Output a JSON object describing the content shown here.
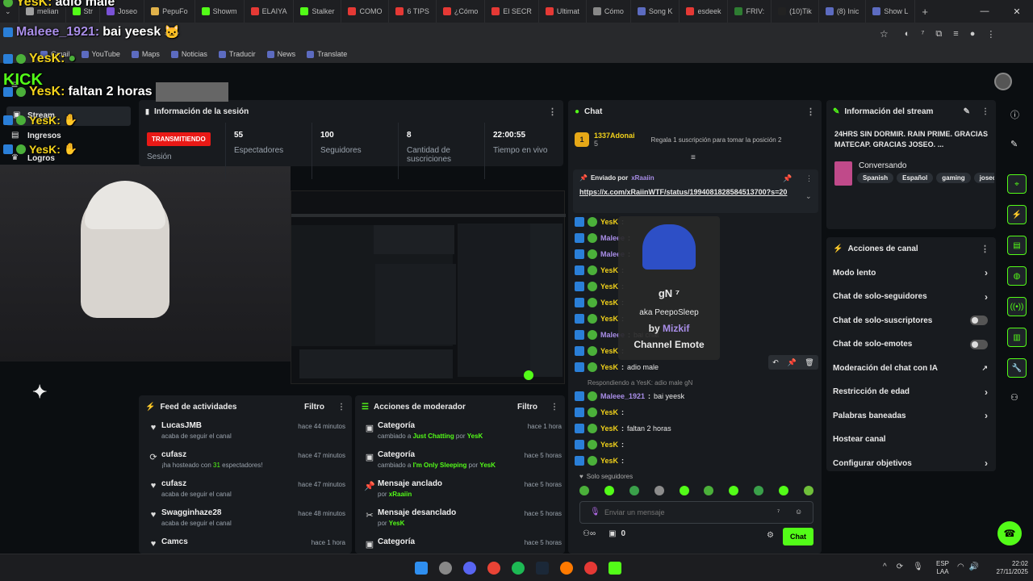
{
  "browser": {
    "tabs": [
      "melian",
      "Str",
      "Joseo",
      "PepuFo",
      "Showm",
      "ELAIYA",
      "Stalker",
      "COMO",
      "6 TIPS",
      "¿Cómo",
      "El SECR",
      "Ultimat",
      "Cómo",
      "Song K",
      "esdeek",
      "FRIV: ",
      "(10)Tik",
      "(8) Inic",
      "Show L"
    ],
    "bookmarks": [
      "Gmail",
      "YouTube",
      "Maps",
      "Noticias",
      "Traducir",
      "News",
      "Translate"
    ]
  },
  "stream_overlay": {
    "line1_user": "YesK:",
    "line1_text": "adio male",
    "line2_user": "Maleee_1921:",
    "line2_text": "bai yeesk",
    "line3_user": "YesK:",
    "line4_brand": "KICK",
    "line4_user": "YesK:",
    "line4_text": "faltan 2 horas",
    "line5_user": "YesK:",
    "line6_user": "YesK:",
    "line7_user": "YesK:"
  },
  "sidebar": {
    "items": [
      {
        "label": "Stream"
      },
      {
        "label": "Ingresos"
      },
      {
        "label": "Logros"
      }
    ]
  },
  "session": {
    "title": "Información de la sesión",
    "live_badge": "TRANSMITIENDO",
    "session_label": "Sesión",
    "stats": [
      {
        "value": "55",
        "label": "Espectadores"
      },
      {
        "value": "100",
        "label": "Seguidores"
      },
      {
        "value": "8",
        "label": "Cantidad de suscriciones"
      },
      {
        "value": "22:00:55",
        "label": "Tiempo en vivo"
      }
    ]
  },
  "feed": {
    "title": "Feed de actividades",
    "filter": "Filtro",
    "items": [
      {
        "name": "LucasJMB",
        "sub": "acaba de seguir el canal",
        "time": "hace 44 minutos",
        "icon": "heart-icon"
      },
      {
        "name": "cufasz",
        "sub_pre": "¡ha hosteado con ",
        "sub_num": "31",
        "sub_post": " espectadores!",
        "time": "hace 47 minutos",
        "icon": "host-icon"
      },
      {
        "name": "cufasz",
        "sub": "acaba de seguir el canal",
        "time": "hace 47 minutos",
        "icon": "heart-icon"
      },
      {
        "name": "Swagginhaze28",
        "sub": "acaba de seguir el canal",
        "time": "hace 48 minutos",
        "icon": "heart-icon"
      },
      {
        "name": "Camcs",
        "sub": "",
        "time": "hace 1 hora",
        "icon": "heart-icon"
      }
    ]
  },
  "modactions": {
    "title": "Acciones de moderador",
    "filter": "Filtro",
    "items": [
      {
        "name": "Categoría",
        "pre": "cambiado a ",
        "hl": "Just Chatting",
        "mid": " por ",
        "who": "YesK",
        "time": "hace 1 hora"
      },
      {
        "name": "Categoría",
        "pre": "cambiado a ",
        "hl": "I'm Only Sleeping",
        "mid": " por ",
        "who": "YesK",
        "time": "hace 5 horas"
      },
      {
        "name": "Mensaje anclado",
        "pre": "por ",
        "hl": "",
        "mid": "",
        "who": "xRaaiin",
        "time": "hace 5 horas"
      },
      {
        "name": "Mensaje desanclado",
        "pre": "por ",
        "hl": "",
        "mid": "",
        "who": "YesK",
        "time": "hace 5 horas"
      },
      {
        "name": "Categoría",
        "pre": "",
        "hl": "",
        "mid": "",
        "who": "",
        "time": "hace 5 horas"
      }
    ]
  },
  "chat": {
    "title": "Chat",
    "gifter_name": "1337Adonai",
    "gifter_count": "5",
    "gift_cta": "Regala 1 suscripción para tomar la posición 2",
    "pinned_by": "Enviado por",
    "pinned_user": "xRaaiin",
    "pinned_link": "https://x.com/xRaiinWTF/status/1994081828584513700?s=20",
    "emote_name": "gN",
    "emote_aka": "aka PeepoSleep",
    "emote_by": "by",
    "emote_author": "Mizkif",
    "emote_type": "Channel Emote",
    "messages": [
      {
        "user": "YesK",
        "text": ""
      },
      {
        "user": "Maleee",
        "text": ""
      },
      {
        "user": "Maleee",
        "text": ""
      },
      {
        "user": "YesK",
        "text": ""
      },
      {
        "user": "YesK",
        "text": ""
      },
      {
        "user": "YesK",
        "text": ""
      },
      {
        "user": "YesK",
        "text": ""
      },
      {
        "user": "Maleee",
        "text": "bai chat"
      },
      {
        "user": "YesK",
        "text": ""
      },
      {
        "user": "YesK",
        "text": "adio male"
      }
    ],
    "reply_to": "Respondiendo a YesK: adio male gN",
    "messages2": [
      {
        "user": "Maleee_1921",
        "text": "bai yeesk"
      },
      {
        "user": "YesK",
        "text": ""
      },
      {
        "user": "YesK",
        "text": "faltan 2 horas"
      },
      {
        "user": "YesK",
        "text": ""
      },
      {
        "user": "YesK",
        "text": ""
      }
    ],
    "followers_only": "Solo seguidores",
    "input_placeholder": "Enviar un mensaje",
    "points": "0",
    "send": "Chat"
  },
  "streaminfo": {
    "title": "Información del stream",
    "stream_title": "24HRS SIN DORMIR. RAIN PRIME. GRACIAS MATECAP. GRACIAS JOSEO. ...",
    "category": "Conversando",
    "tags": [
      "Spanish",
      "Español",
      "gaming",
      "joseo"
    ]
  },
  "channelactions": {
    "title": "Acciones de canal",
    "items": [
      {
        "label": "Modo lento",
        "control": "chevron"
      },
      {
        "label": "Chat de solo-seguidores",
        "control": "chevron"
      },
      {
        "label": "Chat de solo-suscriptores",
        "control": "toggle"
      },
      {
        "label": "Chat de solo-emotes",
        "control": "toggle"
      },
      {
        "label": "Moderación del chat con IA",
        "control": "external"
      },
      {
        "label": "Restricción de edad",
        "control": "chevron"
      },
      {
        "label": "Palabras baneadas",
        "control": "chevron"
      },
      {
        "label": "Hostear canal",
        "control": "none"
      },
      {
        "label": "Configurar objetivos",
        "control": "chevron"
      }
    ]
  },
  "taskbar": {
    "lang1": "ESP",
    "lang2": "LAA",
    "time": "22:02",
    "date": "27/11/2025"
  },
  "colors": {
    "accent": "#53fc18",
    "live": "#e91916",
    "panel": "#181b1f",
    "bg": "#0b0e11"
  }
}
